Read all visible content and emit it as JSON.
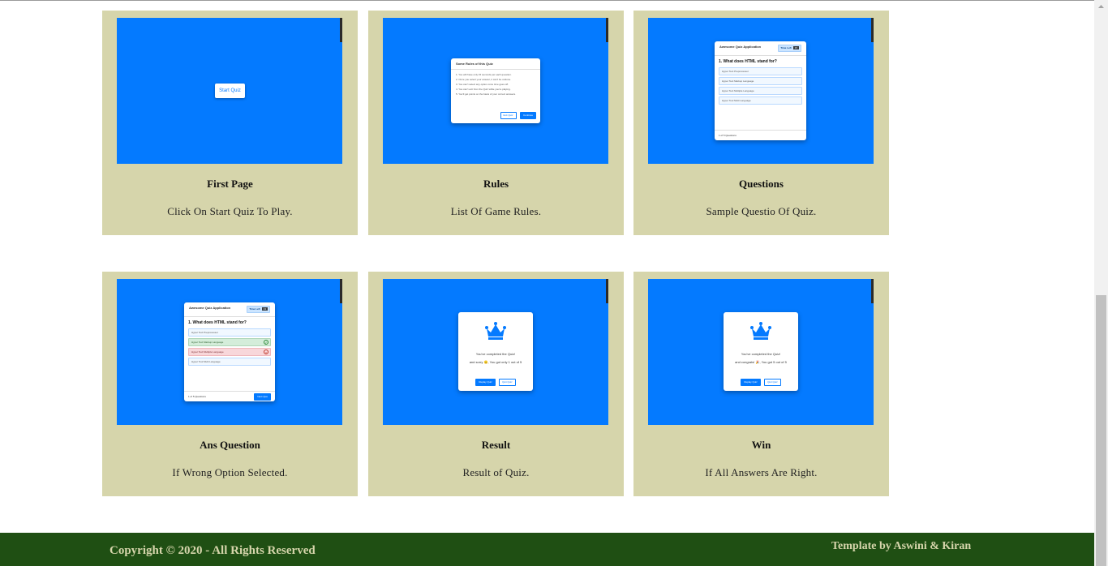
{
  "cards": [
    {
      "title": "First Page",
      "description": "Click On Start Quiz To Play.",
      "preview": {
        "button": "Start Quiz"
      }
    },
    {
      "title": "Rules",
      "description": "List Of Game Rules.",
      "preview": {
        "heading": "Some Rules of this Quiz",
        "rules": [
          "1. You will have only 15 seconds per each question.",
          "2. Once you select your answer, it can't be undone.",
          "3. You can't select any option once time goes off.",
          "4. You can't exit from the Quiz while you're playing.",
          "5. You'll get points on the basis of your correct answers."
        ],
        "exit": "Exit Quiz",
        "continue": "Continue"
      }
    },
    {
      "title": "Questions",
      "description": "Sample Questio Of Quiz.",
      "preview": {
        "app": "Awesome Quiz Application",
        "timer_label": "Time Left",
        "timer_value": "15",
        "question": "1. What does HTML stand for?",
        "options": [
          "Hyper Text Preprocessor",
          "Hyper Text Markup Language",
          "Hyper Text Multiple Language",
          "Hyper Tool Multi Language"
        ],
        "count": "1 of 5 Questions"
      }
    },
    {
      "title": "Ans Question",
      "description": "If Wrong Option Selected.",
      "preview": {
        "app": "Awesome Quiz Application",
        "timer_label": "Time Left",
        "timer_value": "13",
        "question": "1. What does HTML stand for?",
        "options": [
          "Hyper Text Preprocessor",
          "Hyper Text Markup Language",
          "Hyper Text Multiple Language",
          "Hyper Tool Multi Language"
        ],
        "count": "1 of 5 Questions",
        "next": "Next Que"
      }
    },
    {
      "title": "Result",
      "description": "Result of Quiz.",
      "preview": {
        "line1": "You've completed the Quiz!",
        "line2": "and sorry 😐, You got only 1 out of 5",
        "replay": "Replay Quiz",
        "quit": "Quit Quiz"
      }
    },
    {
      "title": "Win",
      "description": "If All Answers Are Right.",
      "preview": {
        "line1": "You've completed the Quiz!",
        "line2": "and congrats! 🎉, You got 5 out of 5",
        "replay": "Replay Quiz",
        "quit": "Quit Quiz"
      }
    }
  ],
  "footer": {
    "copyright": "Copyright © 2020 - All Rights Reserved",
    "credit": "Template by Aswini & Kiran"
  },
  "colors": {
    "card_bg": "#d6d5ab",
    "screenshot_bg": "#047aff",
    "footer_bg": "#1f4f13",
    "footer_text": "#d6d5ab"
  }
}
